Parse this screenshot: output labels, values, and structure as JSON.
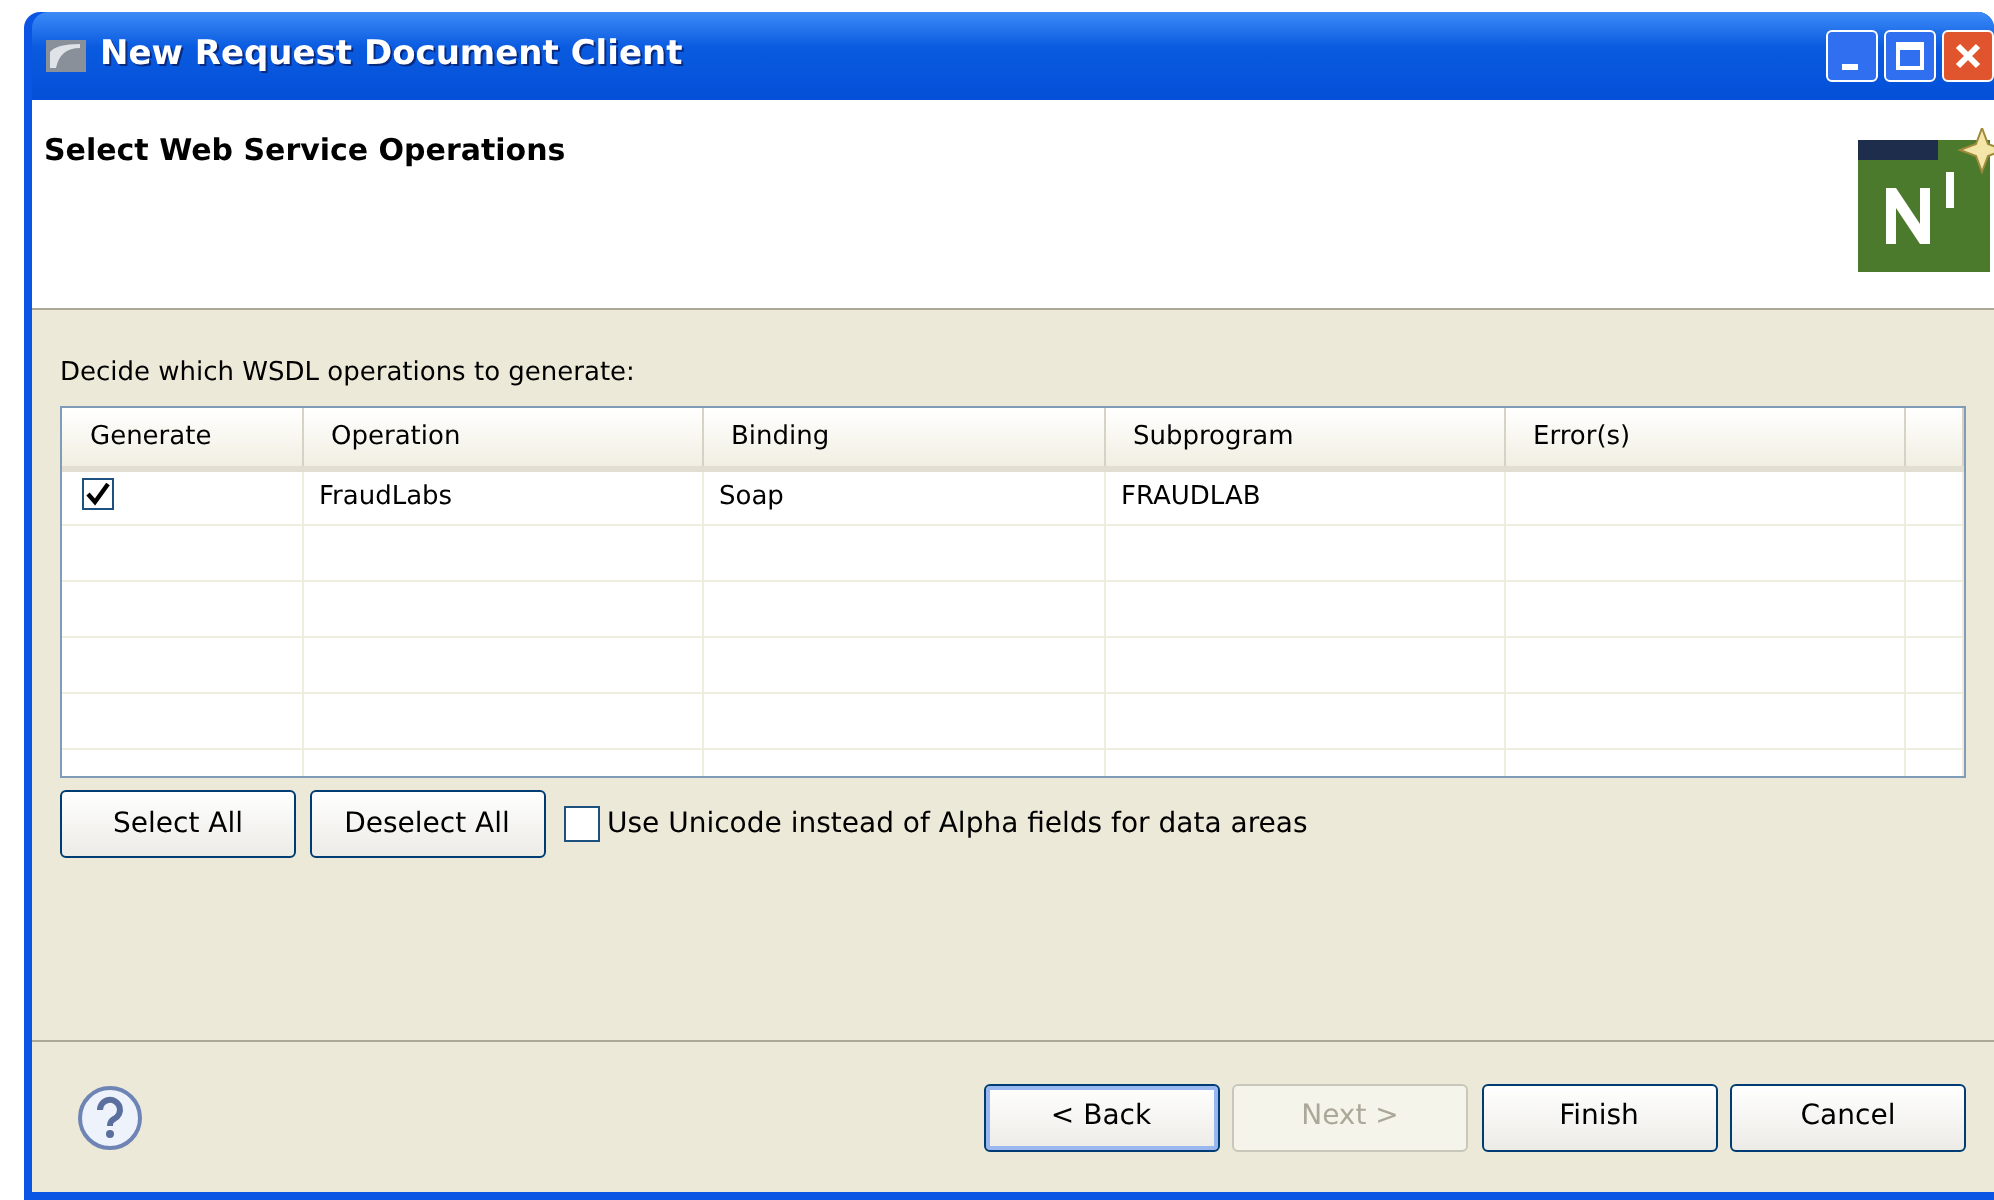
{
  "window": {
    "title": "New Request Document Client"
  },
  "header": {
    "title": "Select Web Service Operations"
  },
  "instruction": "Decide which WSDL operations to generate:",
  "table": {
    "columns": [
      "Generate",
      "Operation",
      "Binding",
      "Subprogram",
      "Error(s)"
    ],
    "rows": [
      {
        "generate": true,
        "operation": "FraudLabs",
        "binding": "Soap",
        "subprogram": "FRAUDLAB"
      }
    ]
  },
  "table_buttons": [
    {
      "label": "Select All"
    },
    {
      "label": "Deselect All"
    }
  ],
  "unicode_option": {
    "label": "Use Unicode instead of Alpha fields for data areas",
    "checked": false
  },
  "footer_buttons": [
    {
      "label": "< Back",
      "default": true,
      "disabled": false
    },
    {
      "label": "Next >",
      "default": false,
      "disabled": true
    },
    {
      "label": "Finish",
      "default": false,
      "disabled": false
    },
    {
      "label": "Cancel",
      "default": false,
      "disabled": false
    }
  ]
}
